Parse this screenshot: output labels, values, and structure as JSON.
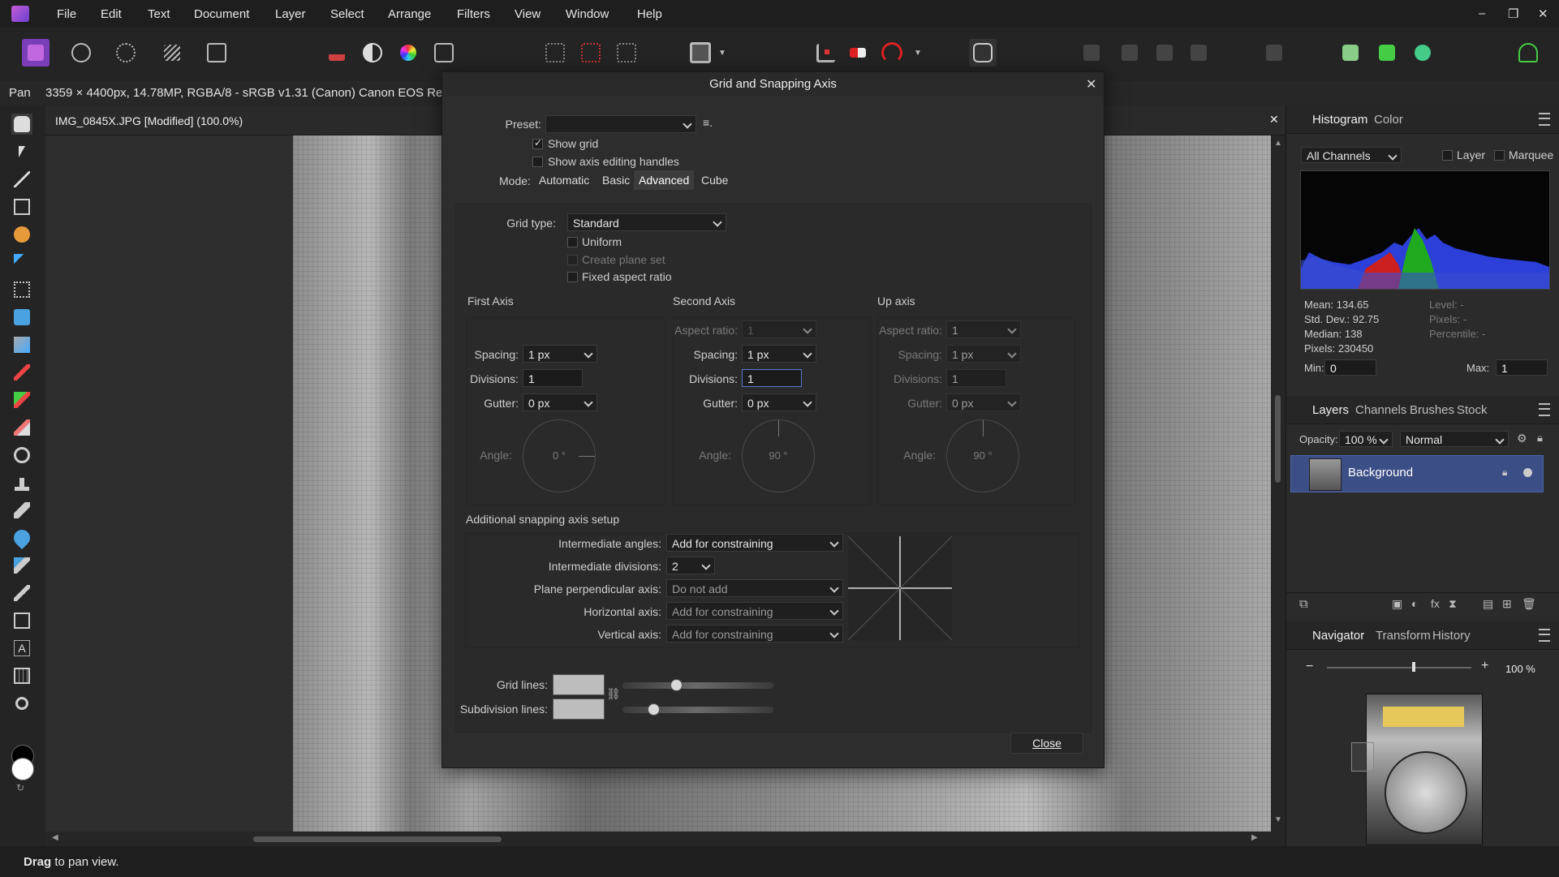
{
  "menubar": {
    "items": [
      "File",
      "Edit",
      "Text",
      "Document",
      "Layer",
      "Select",
      "Arrange",
      "Filters",
      "View",
      "Window",
      "Help"
    ]
  },
  "context": {
    "tool": "Pan",
    "doc_info": "3359 × 4400px, 14.78MP, RGBA/8 - sRGB v1.31 (Canon)",
    "camera": "Canon EOS Reb"
  },
  "document": {
    "tab_title": "IMG_0845X.JPG [Modified] (100.0%)"
  },
  "dialog": {
    "title": "Grid and Snapping Axis",
    "preset_label": "Preset:",
    "preset_value": "",
    "show_grid": "Show grid",
    "show_axis_handles": "Show axis editing handles",
    "mode_label": "Mode:",
    "modes": [
      "Automatic",
      "Basic",
      "Advanced",
      "Cube"
    ],
    "grid_type_label": "Grid type:",
    "grid_type_value": "Standard",
    "uniform": "Uniform",
    "create_plane_set": "Create plane set",
    "fixed_aspect": "Fixed aspect ratio",
    "axes": {
      "first": {
        "title": "First Axis",
        "spacing_label": "Spacing:",
        "spacing": "1 px",
        "divisions_label": "Divisions:",
        "divisions": "1",
        "gutter_label": "Gutter:",
        "gutter": "0 px",
        "angle_label": "Angle:",
        "angle": "0 °"
      },
      "second": {
        "title": "Second Axis",
        "aspect_label": "Aspect ratio:",
        "aspect": "1",
        "spacing_label": "Spacing:",
        "spacing": "1 px",
        "divisions_label": "Divisions:",
        "divisions": "1",
        "gutter_label": "Gutter:",
        "gutter": "0 px",
        "angle_label": "Angle:",
        "angle": "90 °"
      },
      "up": {
        "title": "Up axis",
        "aspect_label": "Aspect ratio:",
        "aspect": "1",
        "spacing_label": "Spacing:",
        "spacing": "1 px",
        "divisions_label": "Divisions:",
        "divisions": "1",
        "gutter_label": "Gutter:",
        "gutter": "0 px",
        "angle_label": "Angle:",
        "angle": "90 °"
      }
    },
    "additional_title": "Additional snapping axis setup",
    "additional": {
      "intermediate_angles_label": "Intermediate angles:",
      "intermediate_angles": "Add for constraining",
      "intermediate_divisions_label": "Intermediate divisions:",
      "intermediate_divisions": "2",
      "plane_perp_label": "Plane perpendicular axis:",
      "plane_perp": "Do not add",
      "horizontal_label": "Horizontal axis:",
      "horizontal": "Add for constraining",
      "vertical_label": "Vertical axis:",
      "vertical": "Add for constraining"
    },
    "grid_lines_label": "Grid lines:",
    "subdivision_lines_label": "Subdivision lines:",
    "grid_lines_opacity": 0.35,
    "subdivision_lines_opacity": 0.2,
    "close_label": "Close"
  },
  "histogram": {
    "tabs": [
      "Histogram",
      "Color"
    ],
    "channel": "All Channels",
    "layer_label": "Layer",
    "marquee_label": "Marquee",
    "mean": "Mean: 134.65",
    "std": "Std. Dev.: 92.75",
    "median": "Median: 138",
    "pixels": "Pixels: 230450",
    "level": "Level: -",
    "pixels2": "Pixels: -",
    "percentile": "Percentile: -",
    "min_label": "Min:",
    "min": "0",
    "max_label": "Max:",
    "max": "1"
  },
  "layers": {
    "tabs": [
      "Layers",
      "Channels",
      "Brushes",
      "Stock"
    ],
    "opacity_label": "Opacity:",
    "opacity": "100 %",
    "blend": "Normal",
    "layer_name": "Background"
  },
  "navigator": {
    "tabs": [
      "Navigator",
      "Transform",
      "History"
    ],
    "zoom": "100 %",
    "zoom_fraction": 0.6,
    "minus": "−",
    "plus": "+"
  },
  "status": {
    "bold": "Drag",
    "rest": " to pan view."
  },
  "colors": {
    "accent": "#3f4f8f",
    "selection": "#3c4e86"
  }
}
